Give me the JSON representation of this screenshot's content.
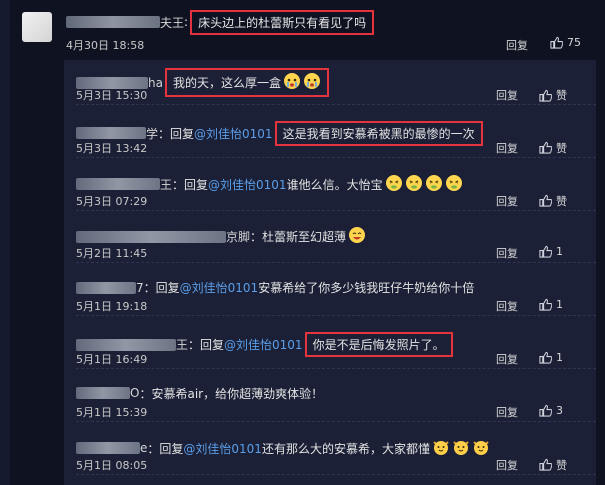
{
  "top_comment": {
    "username_suffix": "夫王",
    "separator": ":",
    "text": "床头边上的杜蕾斯只有看见了吗",
    "time": "4月30日 18:58",
    "reply_label": "回复",
    "like_count": "75"
  },
  "replies": [
    {
      "suffix": "ha",
      "link": "",
      "text": "我的天，这么厚一盒",
      "time": "5月3日 15:30",
      "reply_label": "回复",
      "like_label": "赞",
      "emoji": "crying-face"
    },
    {
      "suffix": "学",
      "prefix": "：回复",
      "link": "@刘佳怡0101",
      "text": "这是我看到安慕希被黑的最惨的一次",
      "time": "5月3日 13:42",
      "reply_label": "回复",
      "like_label": "赞"
    },
    {
      "suffix": "王",
      "prefix": "：回复",
      "link": "@刘佳怡0101",
      "text": "谁他么信。大怡宝",
      "time": "5月3日 07:29",
      "reply_label": "回复",
      "like_label": "赞",
      "emoji": "sick-face"
    },
    {
      "suffix": "京脚",
      "prefix": "：",
      "link": "",
      "text": "杜蕾斯至幻超薄",
      "time": "5月2日 11:45",
      "reply_label": "回复",
      "like_label": "1",
      "emoji": "laughing-face"
    },
    {
      "suffix": "7",
      "prefix": "：回复",
      "link": "@刘佳怡0101",
      "text": "安慕希给了你多少钱我旺仔牛奶给你十倍",
      "time": "5月1日 19:18",
      "reply_label": "回复",
      "like_label": "1"
    },
    {
      "suffix": "王",
      "prefix": "：回复",
      "link": "@刘佳怡0101",
      "text": "你是不是后悔发照片了。",
      "time": "5月1日 16:49",
      "reply_label": "回复",
      "like_label": "1"
    },
    {
      "suffix": "O",
      "prefix": "：",
      "link": "",
      "text": "安慕希air，给你超薄劲爽体验！",
      "time": "5月1日 15:39",
      "reply_label": "回复",
      "like_label": "3"
    },
    {
      "suffix": "e",
      "prefix": "：回复",
      "link": "@刘佳怡0101",
      "text": "还有那么大的安慕希，大家都懂",
      "time": "5月1日 08:05",
      "reply_label": "回复",
      "like_label": "赞",
      "emoji": "cat-face"
    }
  ],
  "colors": {
    "highlight": "#e5333d",
    "link": "#5b9ee9",
    "panel": "#1b2036",
    "background": "#0f1220"
  }
}
